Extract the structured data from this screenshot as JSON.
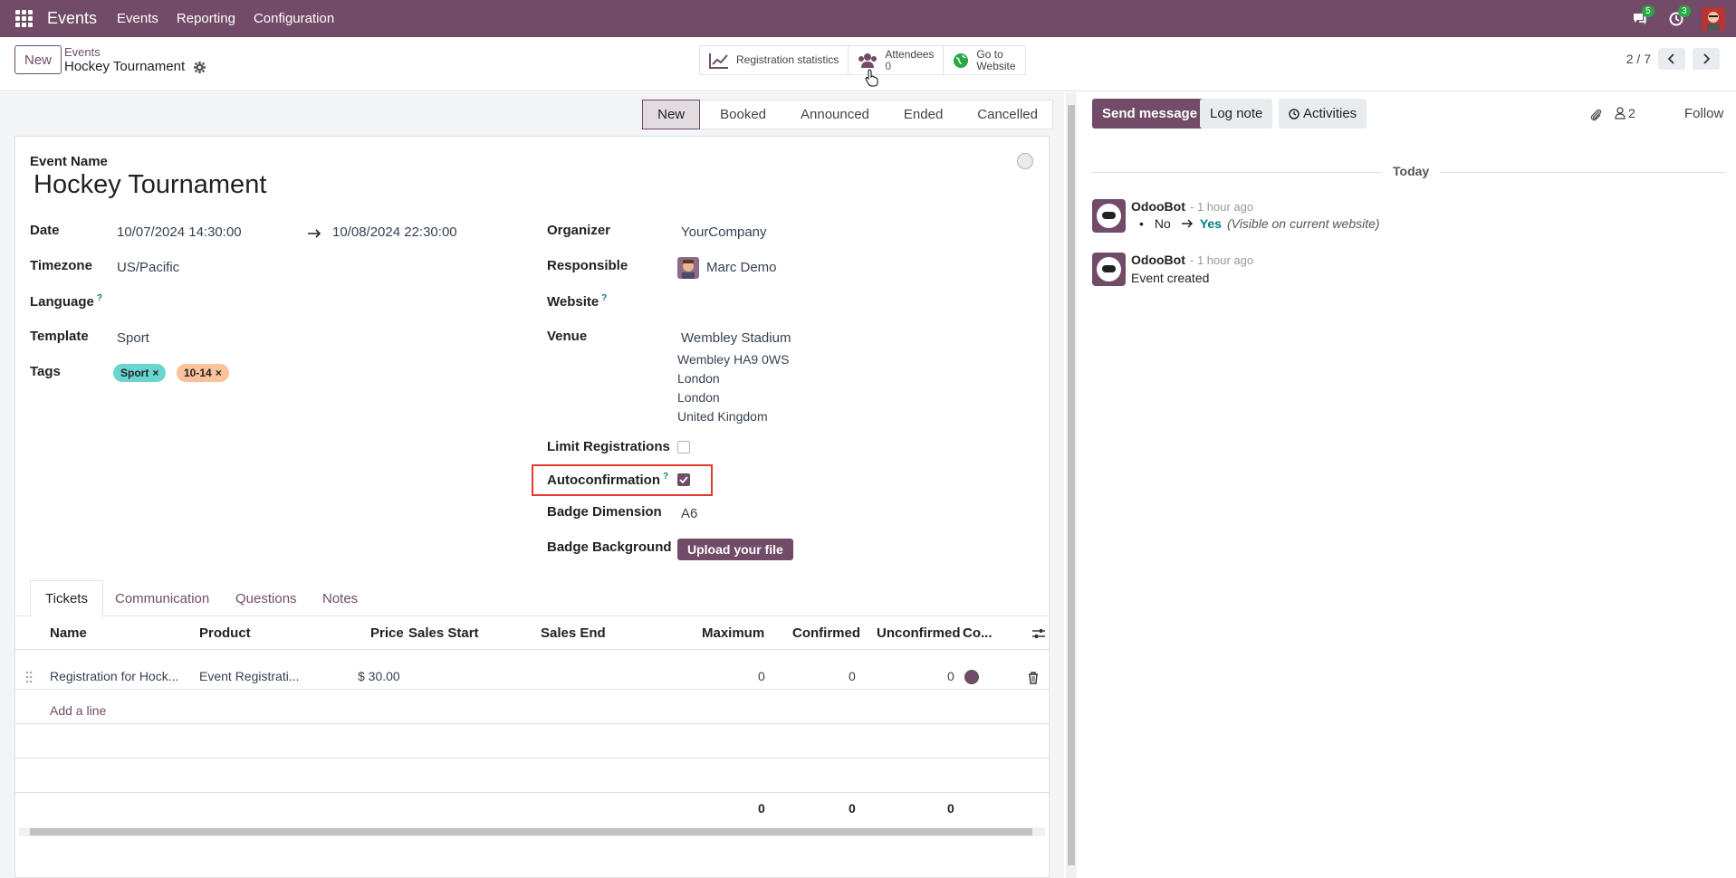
{
  "topbar": {
    "brand": "Events",
    "menu": [
      "Events",
      "Reporting",
      "Configuration"
    ],
    "messages_count": "5",
    "activities_count": "3"
  },
  "control_panel": {
    "new_button": "New",
    "breadcrumb_parent": "Events",
    "breadcrumb_current": "Hockey Tournament",
    "smart_buttons": {
      "registration_statistics": "Registration statistics",
      "attendees_label": "Attendees",
      "attendees_count": "0",
      "go_to": "Go to",
      "website": "Website"
    },
    "pager": "2 / 7"
  },
  "statusbar": [
    "New",
    "Booked",
    "Announced",
    "Ended",
    "Cancelled"
  ],
  "form": {
    "event_name_label": "Event Name",
    "event_name": "Hockey Tournament",
    "date_label": "Date",
    "date_begin": "10/07/2024 14:30:00",
    "date_end": "10/08/2024 22:30:00",
    "timezone_label": "Timezone",
    "timezone": "US/Pacific",
    "language_label": "Language",
    "template_label": "Template",
    "template": "Sport",
    "tags_label": "Tags",
    "tags": [
      {
        "name": "Sport",
        "color": "#6ad5d0"
      },
      {
        "name": "10-14",
        "color": "#f9c29a"
      }
    ],
    "organizer_label": "Organizer",
    "organizer": "YourCompany",
    "responsible_label": "Responsible",
    "responsible": "Marc Demo",
    "website_label": "Website",
    "venue_label": "Venue",
    "venue_name": "Wembley Stadium",
    "venue_lines": [
      "Wembley HA9 0WS",
      "London",
      "London",
      "United Kingdom"
    ],
    "limit_registrations_label": "Limit Registrations",
    "limit_registrations": false,
    "autoconfirmation_label": "Autoconfirmation",
    "autoconfirmation": true,
    "badge_dimension_label": "Badge Dimension",
    "badge_dimension": "A6",
    "badge_background_label": "Badge Background",
    "upload_label": "Upload your file"
  },
  "tabs": [
    "Tickets",
    "Communication",
    "Questions",
    "Notes"
  ],
  "tickets": {
    "columns": [
      "Name",
      "Product",
      "Price",
      "Sales Start",
      "Sales End",
      "Maximum",
      "Confirmed",
      "Unconfirmed",
      "Co..."
    ],
    "rows": [
      {
        "name": "Registration for Hock...",
        "product": "Event Registrati...",
        "price": "$ 30.00",
        "sales_start": "",
        "sales_end": "",
        "maximum": "0",
        "confirmed": "0",
        "unconfirmed": "0",
        "color": "#714B67"
      }
    ],
    "add_line": "Add a line",
    "totals": {
      "maximum": "0",
      "confirmed": "0",
      "unconfirmed": "0"
    }
  },
  "chatter": {
    "send_message": "Send message",
    "log_note": "Log note",
    "activities": "Activities",
    "followers_count": "2",
    "follow": "Follow",
    "today": "Today",
    "messages": [
      {
        "author": "OdooBot",
        "time": "- 1 hour ago",
        "old": "No",
        "new": "Yes",
        "field": "(Visible on current website)"
      },
      {
        "author": "OdooBot",
        "time": "- 1 hour ago",
        "body": "Event created"
      }
    ]
  }
}
